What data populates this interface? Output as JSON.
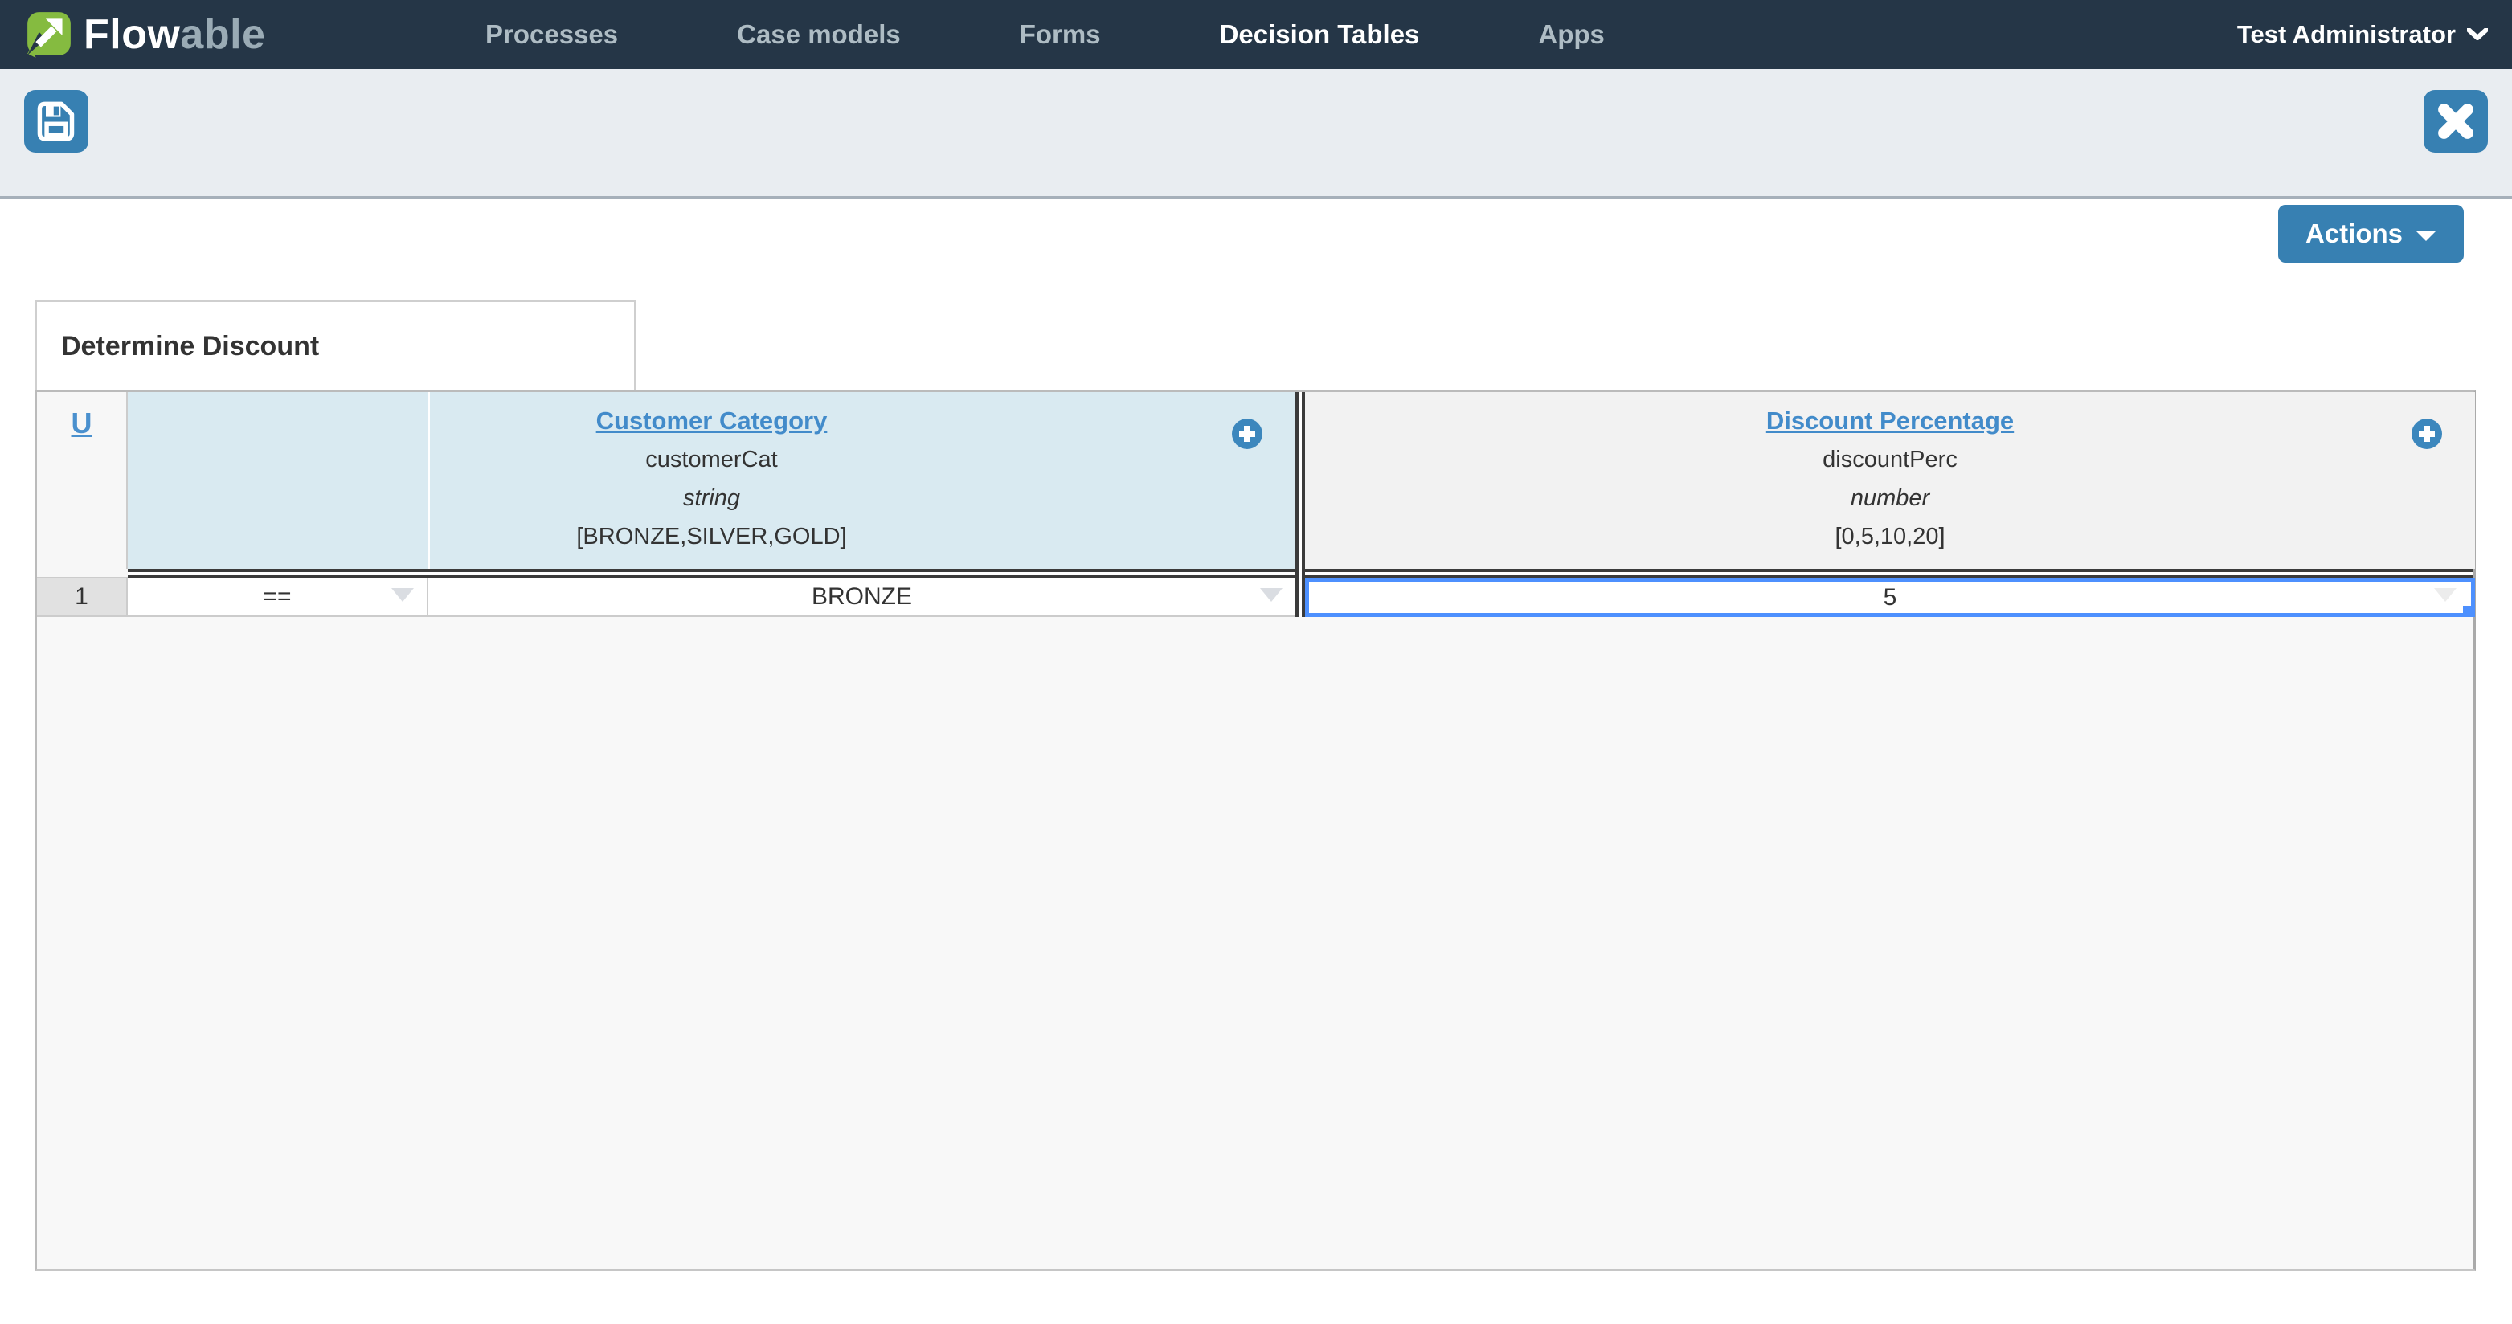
{
  "navbar": {
    "brand": {
      "text_bold": "Flow",
      "text_light": "able"
    },
    "items": [
      {
        "label": "Processes"
      },
      {
        "label": "Case models"
      },
      {
        "label": "Forms"
      },
      {
        "label": "Decision Tables"
      },
      {
        "label": "Apps"
      }
    ],
    "active_item": "Decision Tables",
    "user_menu": {
      "label": "Test Administrator"
    }
  },
  "editor": {
    "actions_button": {
      "label": "Actions"
    },
    "table_name": "Determine Discount",
    "hit_policy": "U"
  },
  "decision_table": {
    "inputs": [
      {
        "label": "Customer Category",
        "variable": "customerCat",
        "type": "string",
        "allowed_values": "[BRONZE,SILVER,GOLD]"
      }
    ],
    "outputs": [
      {
        "label": "Discount Percentage",
        "variable": "discountPerc",
        "type": "number",
        "allowed_values": "[0,5,10,20]"
      }
    ],
    "rules": [
      {
        "number": "1",
        "input_operator": "==",
        "input_value": "BRONZE",
        "output_value": "5"
      }
    ]
  },
  "colors": {
    "navbar_bg": "#253647",
    "toolbar_bg": "#e9edf1",
    "accent_blue": "#3780b2",
    "link_blue": "#428bca",
    "logo_green": "#85bb40",
    "input_header_bg": "#d9eaf1",
    "output_header_bg": "#f2f2f2",
    "selection_blue": "#4d90fe"
  }
}
